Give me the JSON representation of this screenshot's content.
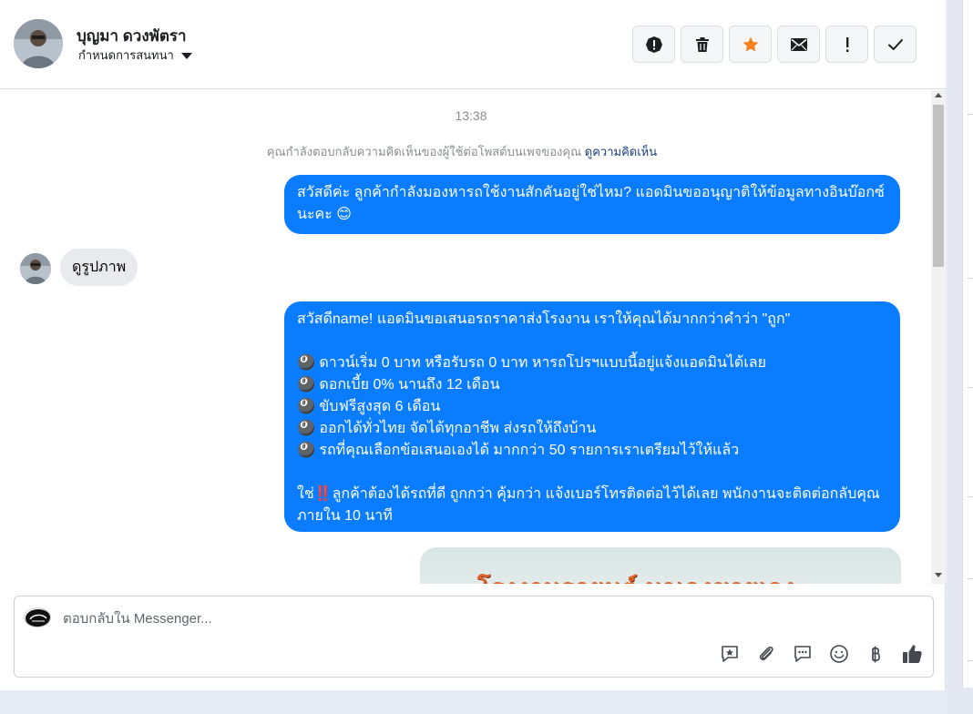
{
  "header": {
    "contact_name": "บุญมา ดวงพัตรา",
    "assign_label": "กำหนดการสนทนา",
    "actions": [
      {
        "name": "report-button",
        "icon": "alert-circle-icon"
      },
      {
        "name": "delete-button",
        "icon": "trash-icon"
      },
      {
        "name": "star-button",
        "icon": "star-icon"
      },
      {
        "name": "mark-unread-button",
        "icon": "envelope-icon"
      },
      {
        "name": "priority-button",
        "icon": "exclamation-icon"
      },
      {
        "name": "done-button",
        "icon": "check-icon"
      }
    ]
  },
  "conversation": {
    "timestamp": "13:38",
    "reply_note": "คุณกำลังตอบกลับความคิดเห็นของผู้ใช้ต่อโพสต์บนเพจของคุณ",
    "reply_note_link": "ดูความคิดเห็น",
    "messages": [
      {
        "direction": "out",
        "text": "สวัสดีค่ะ ลูกค้ากำลังมองหารถใช้งานสักคันอยู่ใช่ไหม? แอดมินขออนุญาติให้ข้อมูลทางอินบ๊อกซ์นะคะ 😊"
      },
      {
        "direction": "in",
        "text": "ดูรูปภาพ"
      },
      {
        "direction": "out",
        "text": "สวัสดีname! แอดมินขอเสนอรถราคาส่งโรงงาน เราให้คุณได้มากกว่าคำว่า \"ถูก\"\n\n🎱 ดาวน์เริ่ม 0 บาท หรือรับรถ 0 บาท หารถโปรฯแบบนี้อยู่แจ้งแอดมินได้เลย\n🎱 ดอกเบี้ย 0% นานถึง 12 เดือน\n🎱 ขับฟรีสูงสุด 6 เดือน\n🎱 ออกได้ทั่วไทย จัดได้ทุกอาชีพ ส่งรถให้ถึงบ้าน\n🎱 รถที่คุณเลือกข้อเสนอเองได้ มากกว่า 50 รายการเราเตรียมไว้ให้แล้ว\n\nใช่‼️ลูกค้าต้องได้รถที่ดี ถูกกว่า คุ้มกว่า แจ้งเบอร์โทรติดต่อไว้ได้เลย พนักงานจะติดต่อกลับคุณภายใน 10 นาที"
      },
      {
        "direction": "out",
        "type": "image",
        "caption_text": "โรงงานรถยนต์ มาเองขายเอง"
      }
    ]
  },
  "composer": {
    "placeholder": "ตอบกลับใน Messenger...",
    "tools": [
      "saved-reply-icon",
      "attachment-icon",
      "chat-bubble-icon",
      "emoji-icon",
      "baht-icon",
      "thumbs-up-icon"
    ]
  },
  "colors": {
    "outgoing_bubble": "#0a7cff",
    "incoming_bubble": "#e9eaed",
    "star_accent": "#f5821f"
  }
}
